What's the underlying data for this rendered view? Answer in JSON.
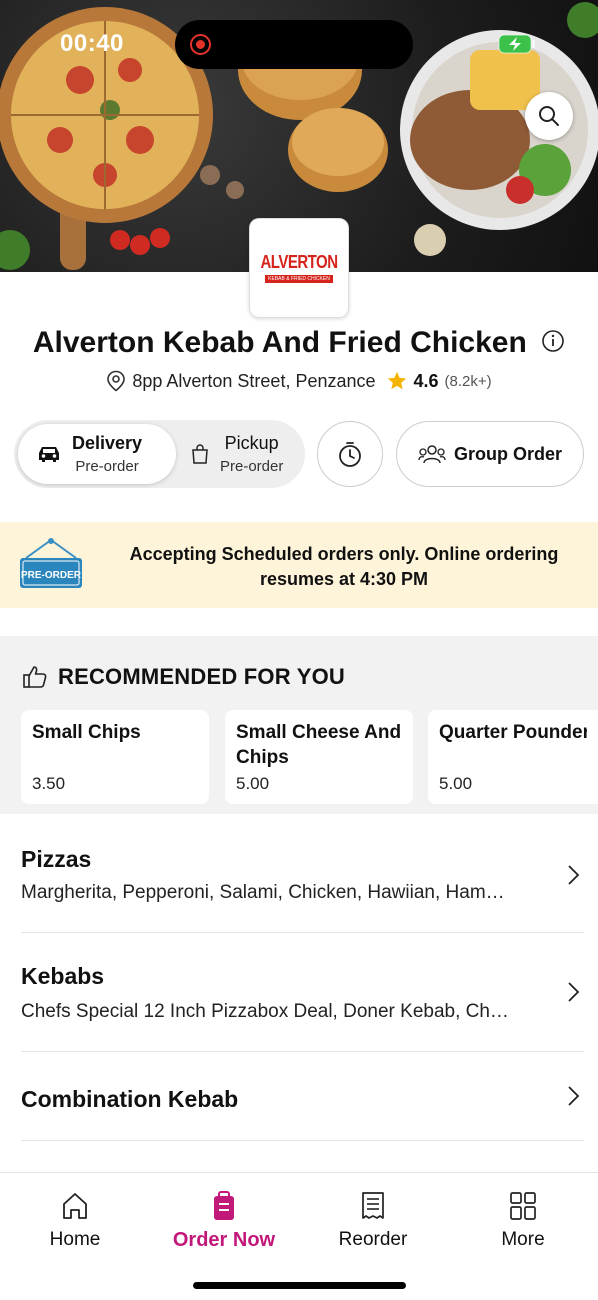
{
  "status": {
    "time": "00:40"
  },
  "restaurant": {
    "logo_main": "ALVERTON",
    "logo_sub": "KEBAB & FRIED CHICKEN",
    "name": "Alverton Kebab And Fried Chicken",
    "address": "8pp Alverton Street, Penzance",
    "rating": "4.6",
    "rating_count": "(8.2k+)"
  },
  "order_type": {
    "delivery_label": "Delivery",
    "delivery_sub": "Pre-order",
    "pickup_label": "Pickup",
    "pickup_sub": "Pre-order",
    "selected": "delivery",
    "group_order_label": "Group Order"
  },
  "banner": {
    "sign_text": "PRE-ORDER",
    "message": "Accepting Scheduled orders only. Online ordering resumes at 4:30 PM"
  },
  "recommended": {
    "title": "RECOMMENDED FOR YOU",
    "items": [
      {
        "name": "Small Chips",
        "price": "3.50"
      },
      {
        "name": "Small Cheese And Chips",
        "price": "5.00"
      },
      {
        "name": "Quarter Pounder Burger",
        "price": "5.00"
      }
    ]
  },
  "categories": [
    {
      "name": "Pizzas",
      "desc": "Margherita, Pepperoni, Salami, Chicken, Hawiian, Ham…"
    },
    {
      "name": "Kebabs",
      "desc": "Chefs Special 12 Inch Pizzabox Deal, Doner Kebab, Ch…"
    },
    {
      "name": "Combination Kebab",
      "desc": ""
    }
  ],
  "nav": {
    "items": [
      {
        "label": "Home",
        "icon": "home-icon"
      },
      {
        "label": "Order Now",
        "icon": "order-bag-icon"
      },
      {
        "label": "Reorder",
        "icon": "receipt-icon"
      },
      {
        "label": "More",
        "icon": "grid-icon"
      }
    ],
    "active": "Order Now"
  },
  "colors": {
    "accent": "#c2187a",
    "banner_bg": "#fdf4d9",
    "star": "#f5b400",
    "logo_red": "#d5241c"
  }
}
